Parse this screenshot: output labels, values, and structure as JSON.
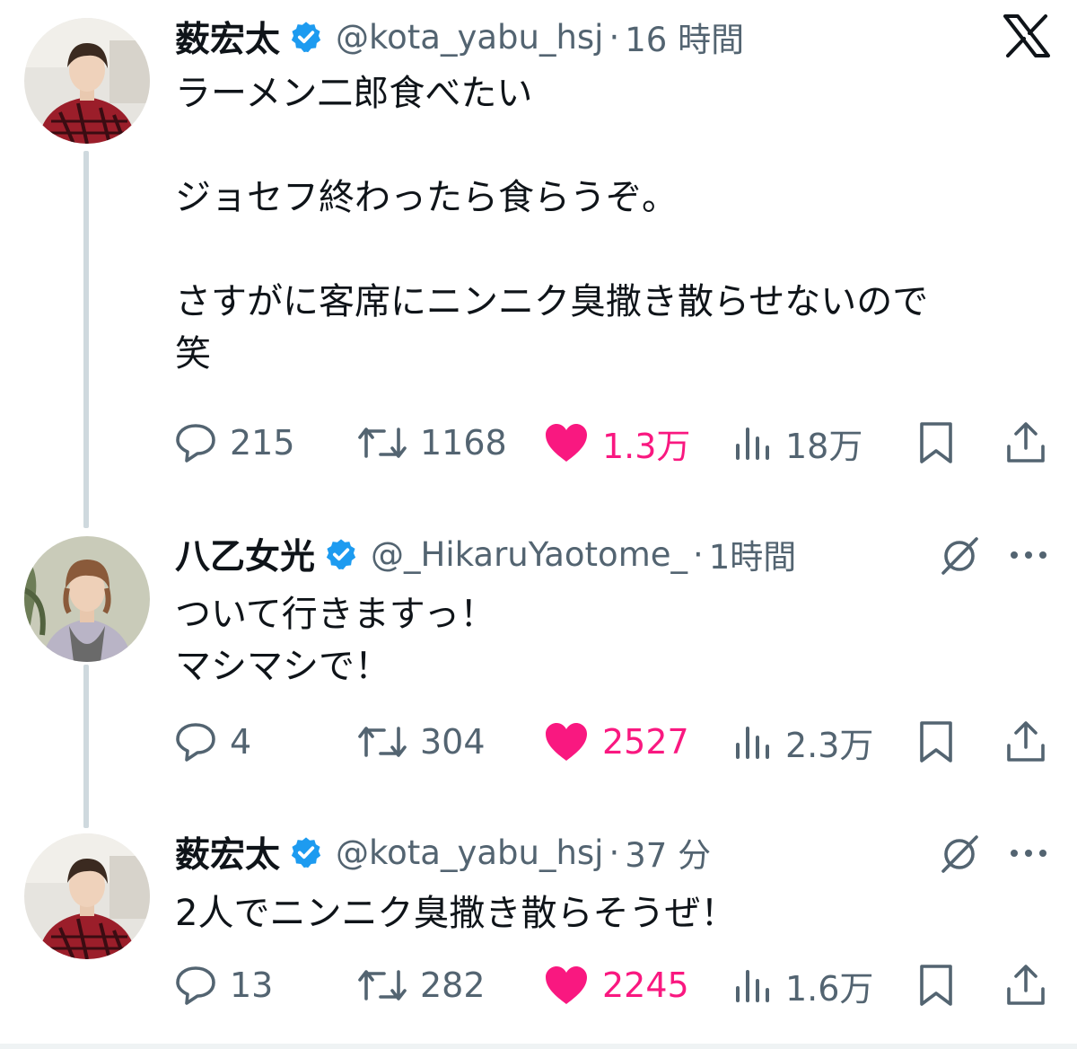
{
  "colors": {
    "verified": "#1d9bf0",
    "like": "#f91880",
    "secondary_text": "#536471",
    "thread_line": "#cfd9de"
  },
  "icons": {
    "brand": "x-logo-icon",
    "reply": "speech-bubble-icon",
    "retweet": "retweet-arrows-icon",
    "like": "heart-filled-icon",
    "views": "bar-chart-icon",
    "bookmark": "bookmark-icon",
    "share": "share-upload-icon",
    "grok": "grok-slash-circle-icon",
    "more": "ellipsis-icon"
  },
  "posts": [
    {
      "display_name": "薮宏太",
      "handle": "@kota_yabu_hsj",
      "separator": "·",
      "time": "16 時間",
      "text": "ラーメン二郎食べたい\n\nジョセフ終わったら食らうぞ。\n\nさすがに客席にニンニク臭撒き散らせないので\n笑",
      "replies": "215",
      "retweets": "1168",
      "likes": "1.3万",
      "views": "18万",
      "liked": true
    },
    {
      "display_name": "八乙女光",
      "handle": "@_HikaruYaotome_",
      "separator": "·",
      "time": "1時間",
      "text": "ついて行きますっ！\nマシマシで！",
      "replies": "4",
      "retweets": "304",
      "likes": "2527",
      "views": "2.3万",
      "liked": true
    },
    {
      "display_name": "薮宏太",
      "handle": "@kota_yabu_hsj",
      "separator": "·",
      "time": "37 分",
      "text": "2人でニンニク臭撒き散らそうぜ！",
      "replies": "13",
      "retweets": "282",
      "likes": "2245",
      "views": "1.6万",
      "liked": true
    }
  ]
}
